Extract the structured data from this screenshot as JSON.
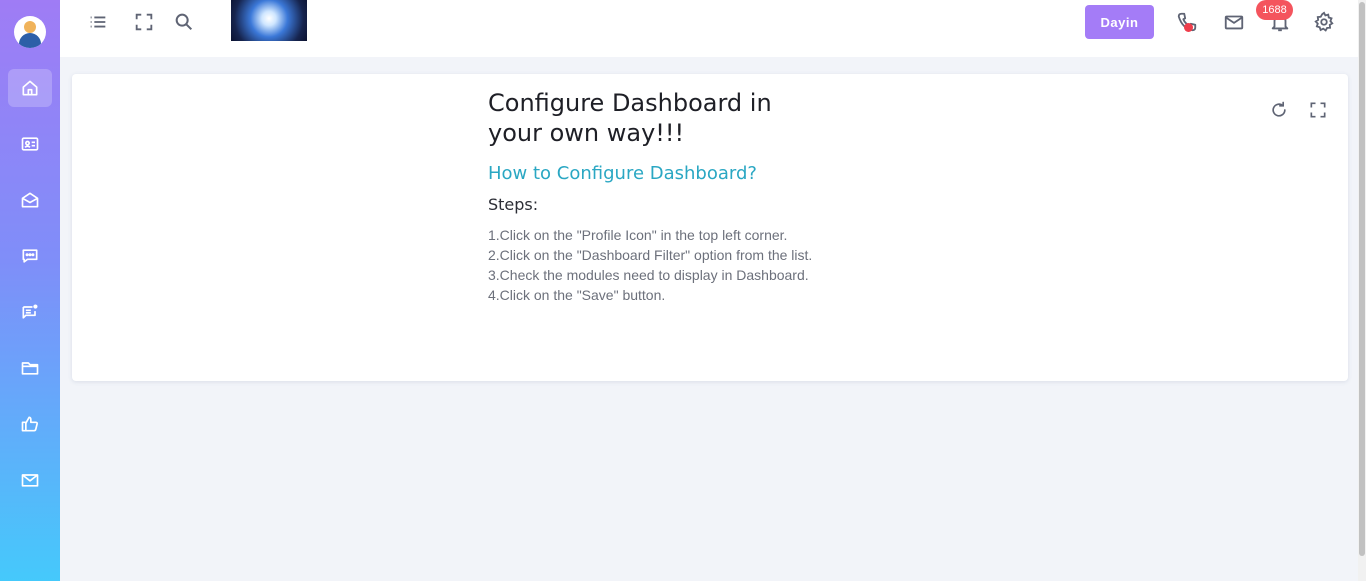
{
  "header": {
    "user_button_label": "Dayin",
    "notification_count": "1688",
    "icons": [
      "menu-icon",
      "fullscreen-icon",
      "search-icon",
      "phone-icon",
      "mail-icon",
      "bell-icon",
      "gear-icon"
    ]
  },
  "sidebar": {
    "items": [
      {
        "icon": "home-icon",
        "active": true
      },
      {
        "icon": "contact-card-icon"
      },
      {
        "icon": "envelope-open-icon"
      },
      {
        "icon": "chat-icon"
      },
      {
        "icon": "feed-icon"
      },
      {
        "icon": "folder-icon"
      },
      {
        "icon": "thumbs-up-icon"
      },
      {
        "icon": "mail-icon"
      }
    ]
  },
  "card": {
    "title": "Configure Dashboard in your own way!!!",
    "subtitle": "How to Configure Dashboard?",
    "steps_label": "Steps:",
    "steps": [
      "1.Click on the \"Profile Icon\" in the top left corner.",
      "2.Click on the \"Dashboard Filter\" option from the list.",
      "3.Check the modules need to display in Dashboard.",
      "4.Click on the \"Save\" button."
    ],
    "tools": [
      "refresh-icon",
      "expand-icon"
    ]
  },
  "colors": {
    "accent": "#a47cf7",
    "subtitle": "#2aa7c3",
    "badge": "#f4545d",
    "sidebar_top": "#9f7cf5",
    "sidebar_bottom": "#45c9fb"
  }
}
